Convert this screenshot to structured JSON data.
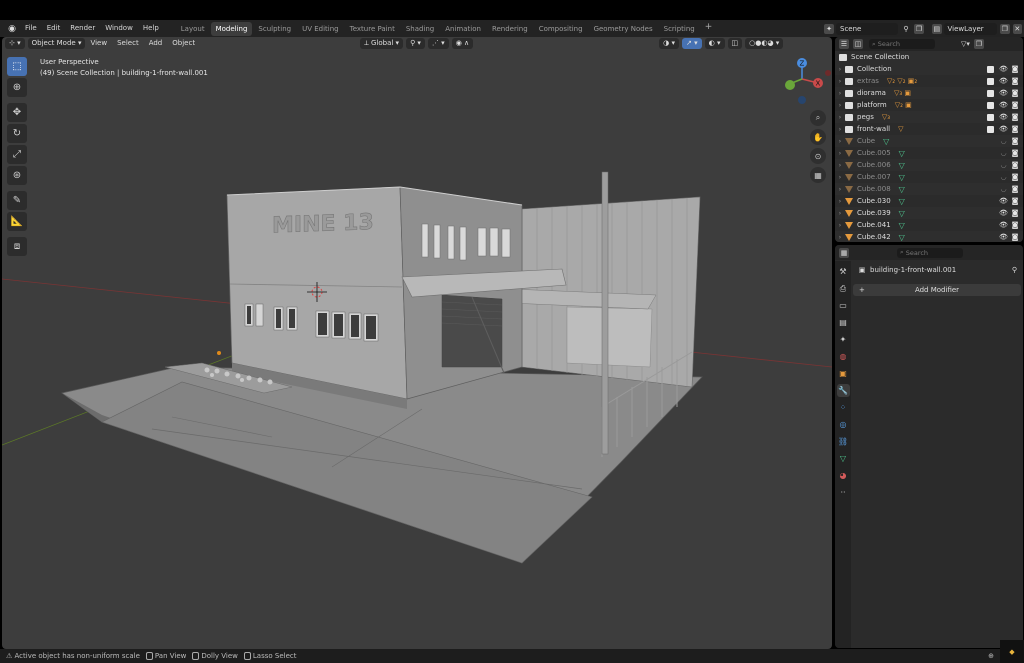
{
  "menu": [
    "File",
    "Edit",
    "Render",
    "Window",
    "Help"
  ],
  "workspaces": [
    "Layout",
    "Modeling",
    "Sculpting",
    "UV Editing",
    "Texture Paint",
    "Shading",
    "Animation",
    "Rendering",
    "Compositing",
    "Geometry Nodes",
    "Scripting"
  ],
  "active_workspace": "Modeling",
  "scene": "Scene",
  "view_layer": "ViewLayer",
  "viewport": {
    "mode": "Object Mode",
    "menus": [
      "View",
      "Select",
      "Add",
      "Object"
    ],
    "transform_orientation": "Global",
    "overlay_line1": "User Perspective",
    "overlay_line2": "(49) Scene Collection | building-1-front-wall.001",
    "sign_text": "MINE 13"
  },
  "outliner": {
    "search_placeholder": "Search",
    "root": "Scene Collection",
    "rows": [
      {
        "label": "Collection",
        "kind": "collection",
        "dim": false,
        "extra": ""
      },
      {
        "label": "extras",
        "kind": "collection",
        "dim": true,
        "extra": "▽₂ ▽₂ ▣₂"
      },
      {
        "label": "diorama",
        "kind": "collection",
        "dim": false,
        "extra": "▽₃ ▣"
      },
      {
        "label": "platform",
        "kind": "collection",
        "dim": false,
        "extra": "▽₂ ▣"
      },
      {
        "label": "pegs",
        "kind": "collection",
        "dim": false,
        "extra": "▽₃"
      },
      {
        "label": "front-wall",
        "kind": "collection",
        "dim": false,
        "extra": "▽"
      },
      {
        "label": "Cube",
        "kind": "mesh",
        "dim": true,
        "extra": "▽"
      },
      {
        "label": "Cube.005",
        "kind": "mesh",
        "dim": true,
        "extra": "▽"
      },
      {
        "label": "Cube.006",
        "kind": "mesh",
        "dim": true,
        "extra": "▽"
      },
      {
        "label": "Cube.007",
        "kind": "mesh",
        "dim": true,
        "extra": "▽"
      },
      {
        "label": "Cube.008",
        "kind": "mesh",
        "dim": true,
        "extra": "▽"
      },
      {
        "label": "Cube.030",
        "kind": "mesh",
        "dim": false,
        "extra": "▽"
      },
      {
        "label": "Cube.039",
        "kind": "mesh",
        "dim": false,
        "extra": "▽"
      },
      {
        "label": "Cube.041",
        "kind": "mesh",
        "dim": false,
        "extra": "▽"
      },
      {
        "label": "Cube.042",
        "kind": "mesh",
        "dim": false,
        "extra": "▽"
      }
    ]
  },
  "properties": {
    "search_placeholder": "Search",
    "object_name": "building-1-front-wall.001",
    "add_modifier": "Add Modifier"
  },
  "status": {
    "message": "Active object has non-uniform scale",
    "pan": "Pan View",
    "dolly": "Dolly View",
    "lasso": "Lasso Select"
  },
  "colors": {
    "accent": "#4772b3",
    "grid_x": "#8b3a3a",
    "grid_y": "#6b8a2a",
    "mesh_orange": "#e59a3d",
    "mesh_green": "#4fc68f"
  }
}
